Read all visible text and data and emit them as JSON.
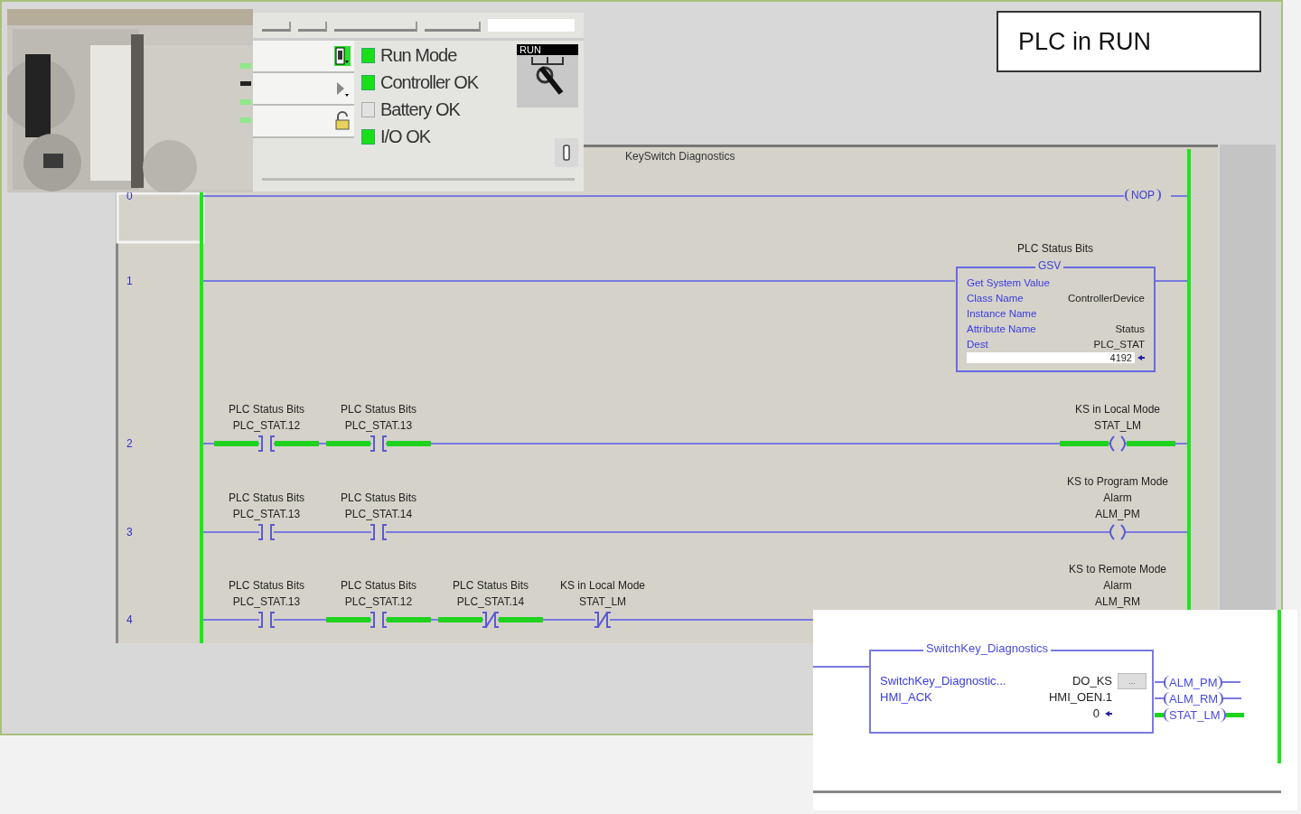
{
  "slide_label": "PLC in RUN",
  "status_panel": {
    "mode_buttons": [
      {
        "selected": true
      },
      {
        "selected": false
      },
      {
        "selected": false
      }
    ],
    "indicators": [
      {
        "label": "Run Mode",
        "on": true
      },
      {
        "label": "Controller OK",
        "on": true
      },
      {
        "label": "Battery OK",
        "on": false
      },
      {
        "label": "I/O OK",
        "on": true
      }
    ],
    "keyswitch": {
      "position": "RUN"
    }
  },
  "ladder": {
    "title": "KeySwitch Diagnostics",
    "rungs": [
      {
        "number": "0",
        "elements": [
          {
            "kind": "nop",
            "label": "NOP"
          }
        ]
      },
      {
        "number": "1",
        "elements": [
          {
            "kind": "gsv",
            "description": "PLC Status Bits",
            "name": "GSV",
            "rows": [
              {
                "label": "Get System Value"
              },
              {
                "label": "Class Name",
                "value": "ControllerDevice"
              },
              {
                "label": "Instance Name"
              },
              {
                "label": "Attribute Name",
                "value": "Status"
              },
              {
                "label": "Dest",
                "value": "PLC_STAT"
              }
            ],
            "reading": "4192"
          }
        ]
      },
      {
        "number": "2",
        "elements": [
          {
            "kind": "xic",
            "description": "PLC Status Bits",
            "tag": "PLC_STAT.12",
            "energized": true
          },
          {
            "kind": "xic",
            "description": "PLC Status Bits",
            "tag": "PLC_STAT.13",
            "energized": true
          },
          {
            "kind": "coil",
            "description": "KS in Local Mode",
            "tag": "STAT_LM",
            "energized": true
          }
        ]
      },
      {
        "number": "3",
        "elements": [
          {
            "kind": "xic",
            "description": "PLC Status Bits",
            "tag": "PLC_STAT.13",
            "energized": false
          },
          {
            "kind": "xic",
            "description": "PLC Status Bits",
            "tag": "PLC_STAT.14",
            "energized": false
          },
          {
            "kind": "coil",
            "description": "KS to Program Mode\nAlarm",
            "tag": "ALM_PM",
            "energized": false
          }
        ]
      },
      {
        "number": "4",
        "elements": [
          {
            "kind": "xic",
            "description": "PLC Status Bits",
            "tag": "PLC_STAT.13",
            "energized": false
          },
          {
            "kind": "xic",
            "description": "PLC Status Bits",
            "tag": "PLC_STAT.12",
            "energized": true
          },
          {
            "kind": "xio",
            "description": "PLC Status Bits",
            "tag": "PLC_STAT.14",
            "energized": true
          },
          {
            "kind": "xio",
            "description": "KS in Local Mode",
            "tag": "STAT_LM",
            "energized": false
          },
          {
            "kind": "coil-label",
            "description": "KS to Remote Mode\nAlarm",
            "tag": "ALM_RM"
          }
        ]
      }
    ]
  },
  "block_inset": {
    "title": "SwitchKey_Diagnostics",
    "rows": [
      {
        "label": "SwitchKey_Diagnostic...",
        "value": "DO_KS"
      },
      {
        "label": "HMI_ACK",
        "value": "HMI_OEN.1"
      }
    ],
    "browse_button": "...",
    "reading": "0",
    "outputs": [
      {
        "tag": "ALM_PM",
        "energized": false
      },
      {
        "tag": "ALM_RM",
        "energized": false
      },
      {
        "tag": "STAT_LM",
        "energized": true
      }
    ]
  }
}
